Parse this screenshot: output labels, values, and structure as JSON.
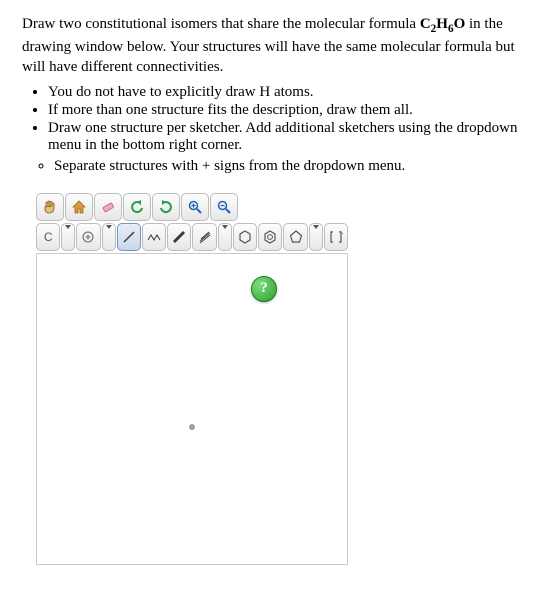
{
  "prompt": {
    "para1_pre": "Draw two constitutional isomers that share the molecular formula ",
    "formula_parts": {
      "a": "C",
      "a_sub": "2",
      "b": "H",
      "b_sub": "6",
      "c": "O"
    },
    "para1_post": " in the drawing window below. Your structures will have the same molecular formula but will have different connectivities.",
    "bullets": [
      "You do not have to explicitly draw H atoms.",
      "If more than one structure fits the description, draw them all.",
      "Draw one structure per sketcher. Add additional sketchers using the dropdown menu in the bottom right corner."
    ],
    "sub_bullets": [
      "Separate structures with + signs from the dropdown menu."
    ]
  },
  "toolbar": {
    "row1": {
      "pan_icon": "pan-hand-icon",
      "home_icon": "home-icon",
      "eraser_icon": "eraser-icon",
      "undo_icon": "undo-icon",
      "redo_icon": "redo-icon",
      "zoom_in_icon": "zoom-in-icon",
      "zoom_out_icon": "zoom-out-icon"
    },
    "row2": {
      "atom_label": "C",
      "charge_icon": "charge-plus-icon",
      "bond_single_icon": "bond-single-icon",
      "bond_tool_icon": "bond-tool-icon",
      "bond_double_icon": "bond-double-icon",
      "bond_triple_icon": "bond-triple-icon",
      "ring_hexagon_icon": "hexagon-icon",
      "ring_benzene_icon": "benzene-icon",
      "ring_pentagon_icon": "pentagon-icon",
      "bracket_icon": "bracket-icon"
    },
    "help_label": "?"
  },
  "canvas": {
    "placeholder": "."
  }
}
